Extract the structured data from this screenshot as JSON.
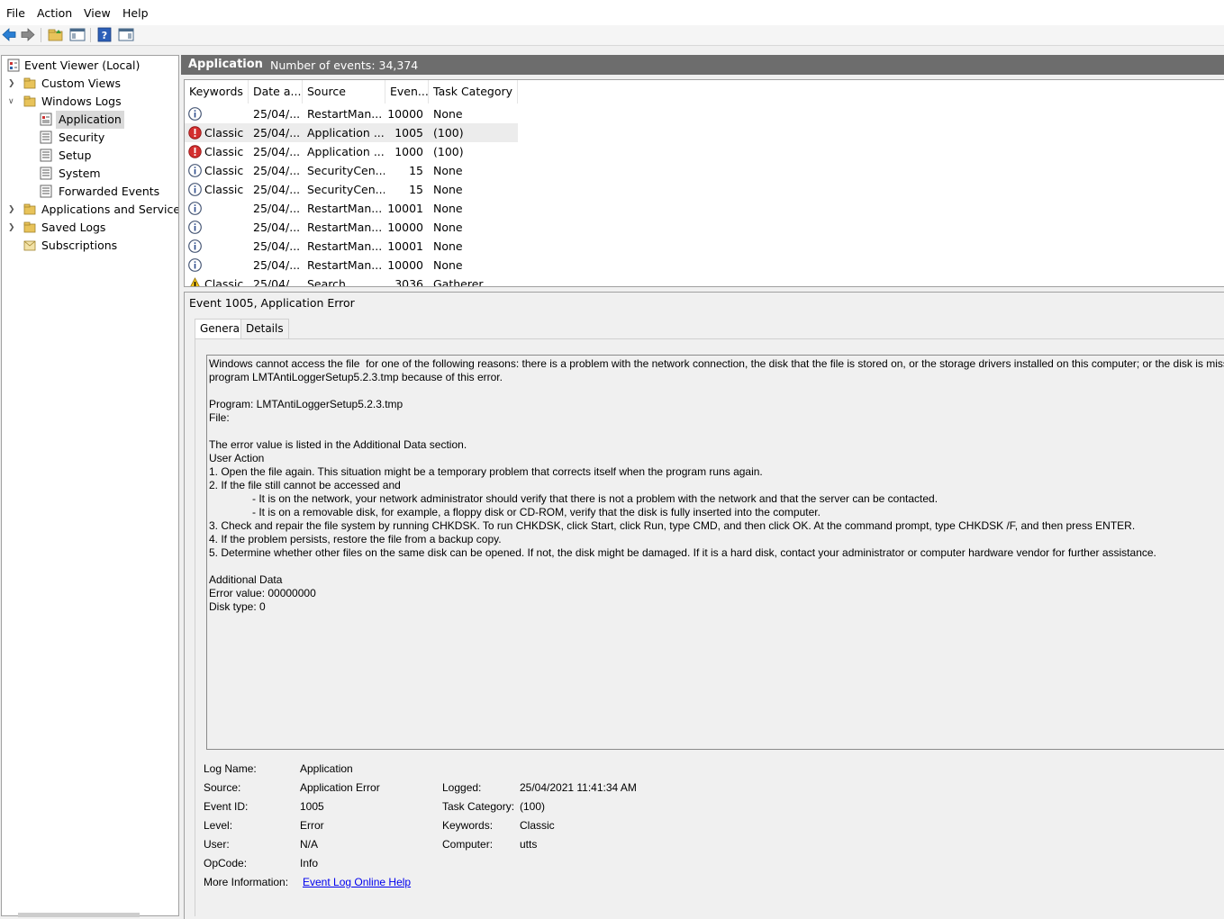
{
  "menu": {
    "file": "File",
    "action": "Action",
    "view": "View",
    "help": "Help"
  },
  "toolbar_icons": [
    "back-arrow-icon",
    "forward-arrow-icon",
    "up-folder-icon",
    "show-hide-console-tree-icon",
    "help-icon",
    "action-pane-icon"
  ],
  "tree": {
    "root": "Event Viewer (Local)",
    "custom_views": "Custom Views",
    "windows_logs": "Windows Logs",
    "application": "Application",
    "security": "Security",
    "setup": "Setup",
    "system": "System",
    "forwarded_events": "Forwarded Events",
    "apps_services": "Applications and Services",
    "saved_logs": "Saved Logs",
    "subscriptions": "Subscriptions"
  },
  "header": {
    "title": "Application",
    "count": "Number of events: 34,374"
  },
  "columns": {
    "keywords": "Keywords",
    "date": "Date a...",
    "source": "Source",
    "event": "Even...",
    "task": "Task Category"
  },
  "events": [
    {
      "level": "info",
      "keywords": "",
      "date": "25/04/...",
      "source": "RestartMan...",
      "id": "10000",
      "task": "None"
    },
    {
      "level": "error",
      "keywords": "Classic",
      "date": "25/04/...",
      "source": "Application ...",
      "id": "1005",
      "task": "(100)"
    },
    {
      "level": "error",
      "keywords": "Classic",
      "date": "25/04/...",
      "source": "Application ...",
      "id": "1000",
      "task": "(100)"
    },
    {
      "level": "info",
      "keywords": "Classic",
      "date": "25/04/...",
      "source": "SecurityCen...",
      "id": "15",
      "task": "None"
    },
    {
      "level": "info",
      "keywords": "Classic",
      "date": "25/04/...",
      "source": "SecurityCen...",
      "id": "15",
      "task": "None"
    },
    {
      "level": "info",
      "keywords": "",
      "date": "25/04/...",
      "source": "RestartMan...",
      "id": "10001",
      "task": "None"
    },
    {
      "level": "info",
      "keywords": "",
      "date": "25/04/...",
      "source": "RestartMan...",
      "id": "10000",
      "task": "None"
    },
    {
      "level": "info",
      "keywords": "",
      "date": "25/04/...",
      "source": "RestartMan...",
      "id": "10001",
      "task": "None"
    },
    {
      "level": "info",
      "keywords": "",
      "date": "25/04/...",
      "source": "RestartMan...",
      "id": "10000",
      "task": "None"
    },
    {
      "level": "warning",
      "keywords": "Classic",
      "date": "25/04/...",
      "source": "Search",
      "id": "3036",
      "task": "Gatherer"
    }
  ],
  "detail": {
    "title": "Event 1005, Application Error",
    "tab_general": "General",
    "tab_details": "Details",
    "description": "Windows cannot access the file  for one of the following reasons: there is a problem with the network connection, the disk that the file is stored on, or the storage drivers installed on this computer; or the disk is missi\nprogram LMTAntiLoggerSetup5.2.3.tmp because of this error.\n\nProgram: LMTAntiLoggerSetup5.2.3.tmp\nFile: \n\nThe error value is listed in the Additional Data section.\nUser Action\n1. Open the file again. This situation might be a temporary problem that corrects itself when the program runs again.\n2. If the file still cannot be accessed and\n\t- It is on the network, your network administrator should verify that there is not a problem with the network and that the server can be contacted.\n\t- It is on a removable disk, for example, a floppy disk or CD-ROM, verify that the disk is fully inserted into the computer.\n3. Check and repair the file system by running CHKDSK. To run CHKDSK, click Start, click Run, type CMD, and then click OK. At the command prompt, type CHKDSK /F, and then press ENTER.\n4. If the problem persists, restore the file from a backup copy.\n5. Determine whether other files on the same disk can be opened. If not, the disk might be damaged. If it is a hard disk, contact your administrator or computer hardware vendor for further assistance.\n\nAdditional Data\nError value: 00000000\nDisk type: 0",
    "props": {
      "log_name_label": "Log Name:",
      "log_name": "Application",
      "source_label": "Source:",
      "source": "Application Error",
      "logged_label": "Logged:",
      "logged": "25/04/2021 11:41:34 AM",
      "event_id_label": "Event ID:",
      "event_id": "1005",
      "task_label": "Task Category:",
      "task": "(100)",
      "level_label": "Level:",
      "level": "Error",
      "keywords_label": "Keywords:",
      "keywords": "Classic",
      "user_label": "User:",
      "user": "N/A",
      "computer_label": "Computer:",
      "computer": "utts",
      "opcode_label": "OpCode:",
      "opcode": "Info",
      "more_info_label": "More Information:",
      "more_info_link": "Event Log Online Help"
    }
  }
}
